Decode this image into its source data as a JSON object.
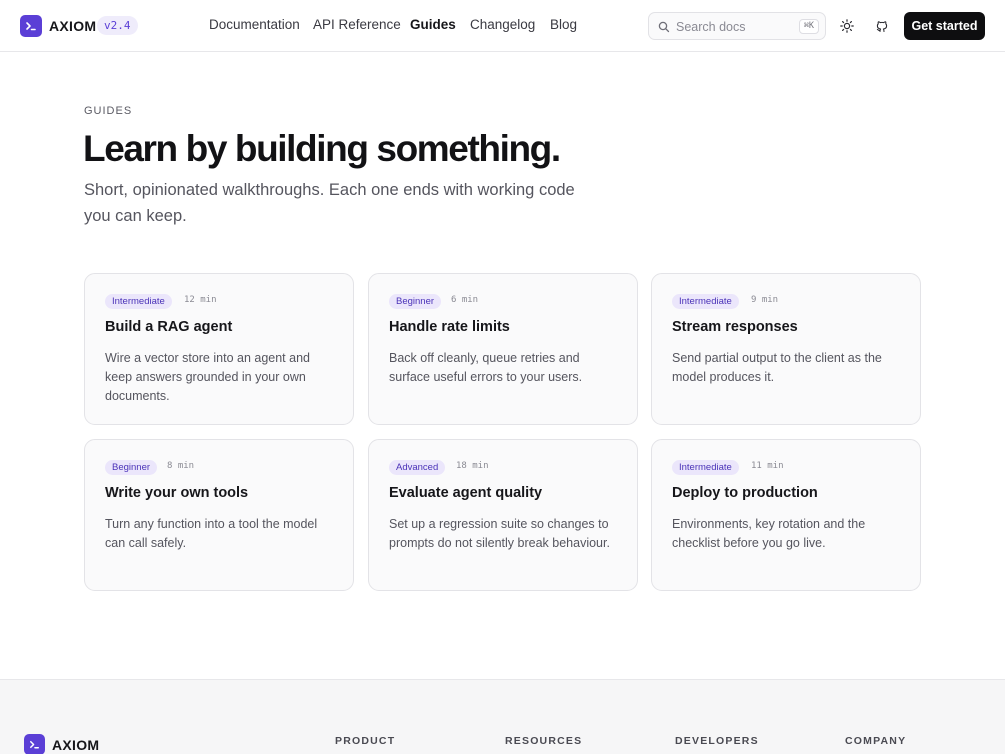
{
  "brand": {
    "name": "AXIOM",
    "version": "v2.4",
    "accent": "#5b3fd6"
  },
  "nav": [
    {
      "label": "Documentation",
      "active": false
    },
    {
      "label": "API Reference",
      "active": false
    },
    {
      "label": "Guides",
      "active": true
    },
    {
      "label": "Changelog",
      "active": false
    },
    {
      "label": "Blog",
      "active": false
    }
  ],
  "search": {
    "placeholder": "Search docs",
    "shortcut": "⌘K"
  },
  "header_actions": {
    "theme_icon": "sun-icon",
    "github_icon": "github-icon",
    "cta_label": "Get started"
  },
  "hero": {
    "eyebrow": "GUIDES",
    "title": "Learn by building something.",
    "subtitle": "Short, opinionated walkthroughs. Each one ends with working code you can keep."
  },
  "guides": [
    {
      "level": "Intermediate",
      "duration": "12 min",
      "title": "Build a RAG agent",
      "description": "Wire a vector store into an agent and keep answers grounded in your own documents."
    },
    {
      "level": "Beginner",
      "duration": "6 min",
      "title": "Handle rate limits",
      "description": "Back off cleanly, queue retries and surface useful errors to your users."
    },
    {
      "level": "Intermediate",
      "duration": "9 min",
      "title": "Stream responses",
      "description": "Send partial output to the client as the model produces it."
    },
    {
      "level": "Beginner",
      "duration": "8 min",
      "title": "Write your own tools",
      "description": "Turn any function into a tool the model can call safely."
    },
    {
      "level": "Advanced",
      "duration": "18 min",
      "title": "Evaluate agent quality",
      "description": "Set up a regression suite so changes to prompts do not silently break behaviour."
    },
    {
      "level": "Intermediate",
      "duration": "11 min",
      "title": "Deploy to production",
      "description": "Environments, key rotation and the checklist before you go live."
    }
  ],
  "footer": {
    "brand": "AXIOM",
    "columns": [
      "PRODUCT",
      "RESOURCES",
      "DEVELOPERS",
      "COMPANY"
    ]
  }
}
